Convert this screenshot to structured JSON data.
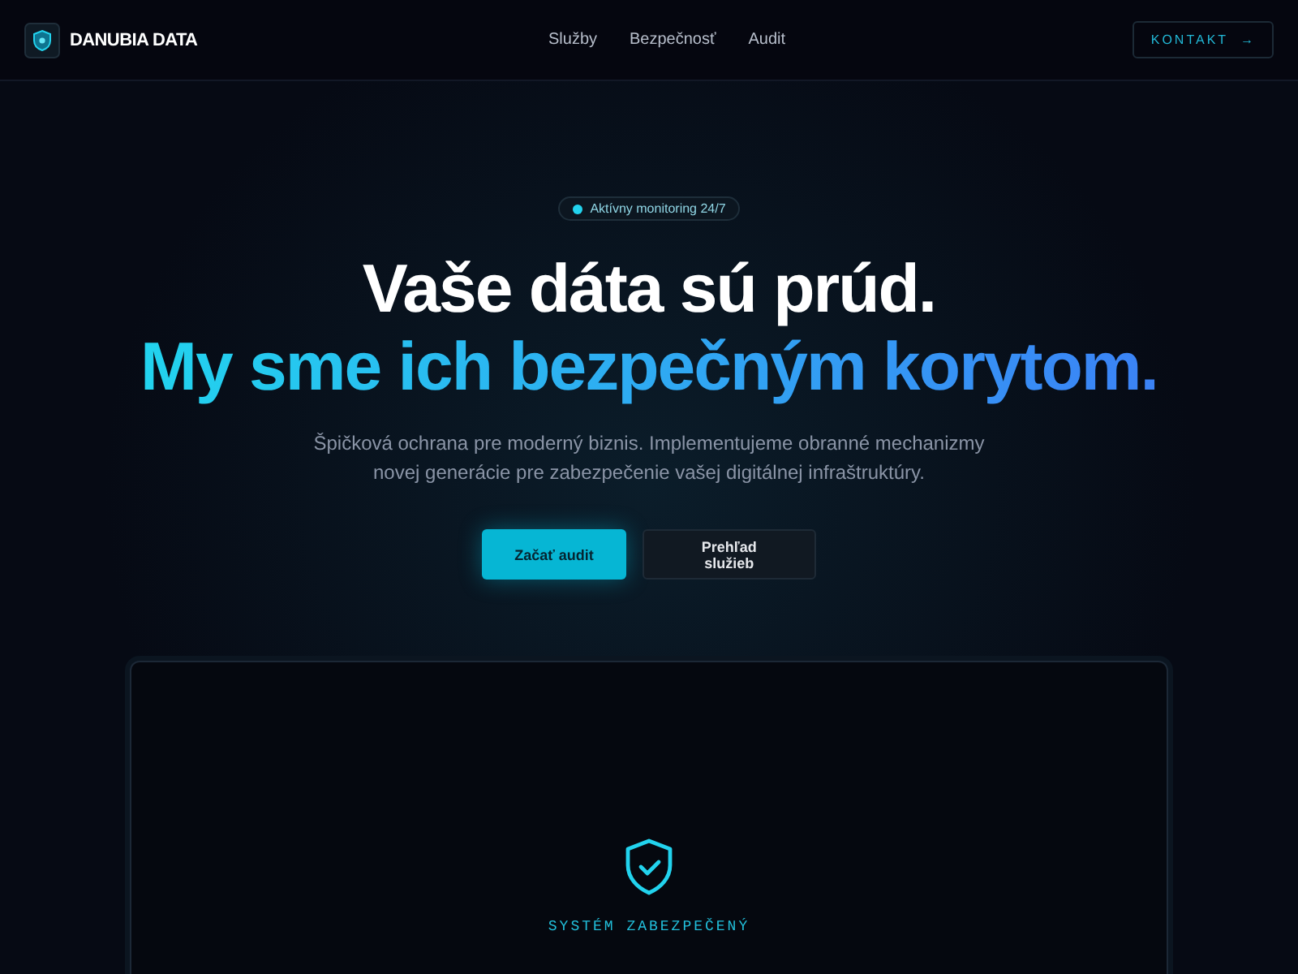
{
  "brand": {
    "name": "DANUBIA DATA"
  },
  "nav": [
    {
      "label": "Služby"
    },
    {
      "label": "Bezpečnosť"
    },
    {
      "label": "Audit"
    }
  ],
  "contact_button": {
    "label": "KONTAKT",
    "arrow": "→"
  },
  "badge": {
    "label": "Aktívny monitoring 24/7"
  },
  "headline": {
    "line_1": "Vaše dáta sú prúd.",
    "line_2": "My sme ich bezpečným korytom."
  },
  "intro": "Špičková ochrana pre moderný biznis. Implementujeme obranné mechanizmy novej generácie pre zabezpečenie vašej digitálnej infraštruktúry.",
  "buttons": [
    {
      "label": "Začať audit",
      "kind": "primary"
    },
    {
      "label": "Prehľad služieb",
      "kind": "secondary"
    }
  ],
  "status_panel": {
    "label": "SYSTÉM ZABEZPEČENÝ"
  }
}
